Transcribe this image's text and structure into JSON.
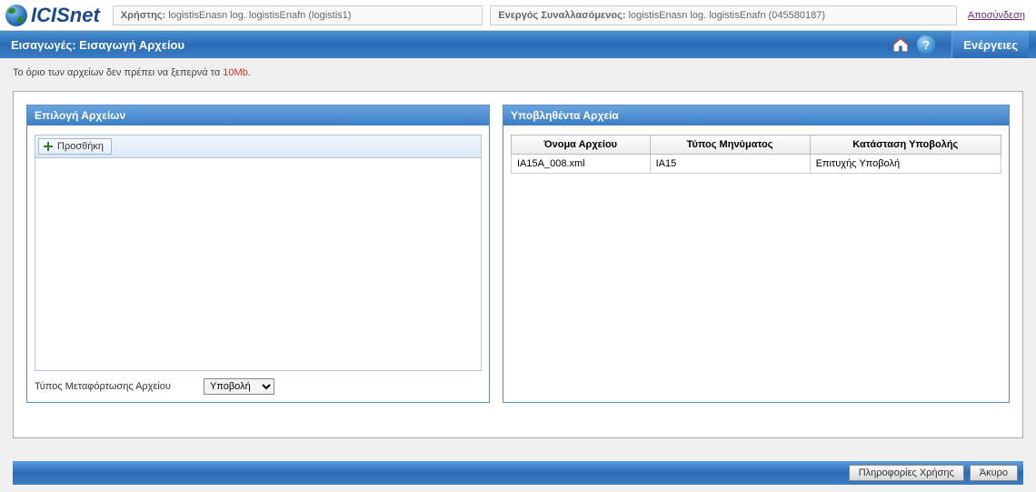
{
  "logo_text": "ICISnet",
  "top": {
    "user_label": "Χρήστης:",
    "user_value": "logistisEnasn log. logistisEnafn (logistis1)",
    "trader_label": "Ενεργός Συναλλασόμενος:",
    "trader_value": "logistisEnasn log. logistisEnafn (045580187)",
    "logout": "Αποσύνδεση"
  },
  "title": "Εισαγωγές: Εισαγωγή Αρχείου",
  "actions_label": "Ενέργειες",
  "info_prefix": "Το όριο των αρχείων δεν πρέπει να ξεπερνά τα ",
  "info_limit": "10Mb",
  "info_suffix": ".",
  "left_panel": {
    "title": "Επιλογή Αρχείων",
    "add_button": "Προσθήκη",
    "upload_type_label": "Τύπος Μεταφόρτωσης Αρχείου",
    "upload_type_value": "Υποβολή"
  },
  "right_panel": {
    "title": "Υποβληθέντα Αρχεία",
    "columns": {
      "filename": "Όνομα Αρχείου",
      "msgtype": "Τύπος Μηνύματος",
      "status": "Κατάσταση Υποβολής"
    },
    "rows": [
      {
        "filename": "IA15A_008.xml",
        "msgtype": "IA15",
        "status": "Επιτυχής Υποβολή"
      }
    ]
  },
  "footer": {
    "usage_info": "Πληροφορίες Χρήσης",
    "cancel": "Άκυρο"
  }
}
